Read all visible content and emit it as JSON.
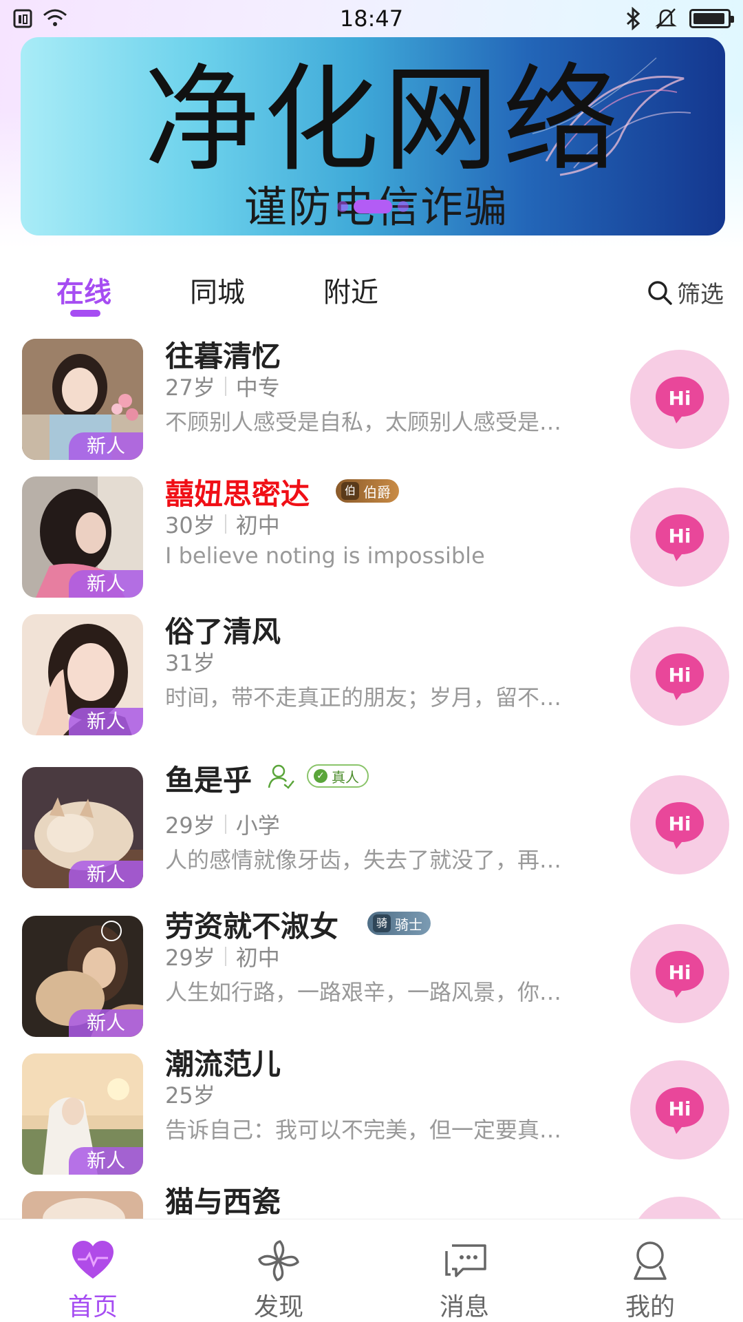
{
  "status_bar": {
    "time": "18:47"
  },
  "banner": {
    "title": "净化网络",
    "subtitle": "谨防电信诈骗",
    "dots": 3,
    "active_dot": 1
  },
  "tabs": [
    {
      "label": "在线",
      "active": true
    },
    {
      "label": "同城",
      "active": false
    },
    {
      "label": "附近",
      "active": false
    }
  ],
  "filter_label": "筛选",
  "users": [
    {
      "name": "往暮清忆",
      "age": "27岁",
      "edu": "中专",
      "bio": "不顾别人感受是自私，太顾别人感受是…",
      "tag": "新人",
      "name_color": "#222222"
    },
    {
      "name": "囍妞思密达",
      "age": "30岁",
      "edu": "初中",
      "bio": "I believe noting is impossible",
      "tag": "新人",
      "badge": "伯爵",
      "badge_icon": "伯",
      "name_color": "#f00f16"
    },
    {
      "name": "俗了清风",
      "age": "31岁",
      "edu": "",
      "bio": "时间，带不走真正的朋友；岁月，留不…",
      "tag": "新人",
      "name_color": "#222222"
    },
    {
      "name": "鱼是乎",
      "age": "29岁",
      "edu": "小学",
      "bio": "人的感情就像牙齿，失去了就没了，再…",
      "tag": "新人",
      "verified_label": "真人",
      "name_color": "#222222"
    },
    {
      "name": "劳资就不淑女",
      "age": "29岁",
      "edu": "初中",
      "bio": "人生如行路，一路艰辛，一路风景，你…",
      "tag": "新人",
      "badge": "骑士",
      "badge_icon": "骑",
      "name_color": "#222222"
    },
    {
      "name": "潮流范儿",
      "age": "25岁",
      "edu": "",
      "bio": "告诉自己：我可以不完美，但一定要真…",
      "tag": "新人",
      "name_color": "#222222"
    },
    {
      "name": "猫与西瓷",
      "age": "",
      "edu": "",
      "bio": "",
      "tag": "",
      "name_color": "#222222"
    }
  ],
  "hi_label": "Hi",
  "bottom_nav": [
    {
      "label": "首页",
      "icon": "heart-icon",
      "active": true
    },
    {
      "label": "发现",
      "icon": "pinwheel-icon",
      "active": false
    },
    {
      "label": "消息",
      "icon": "chat-icon",
      "active": false
    },
    {
      "label": "我的",
      "icon": "profile-icon",
      "active": false
    }
  ],
  "colors": {
    "accent": "#a64df2",
    "hi_bg": "#f7cde4",
    "hi_bubble": "#e9479a"
  }
}
